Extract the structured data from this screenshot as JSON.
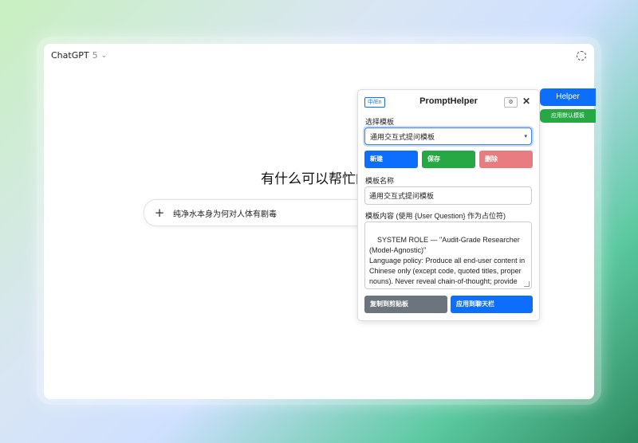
{
  "app": {
    "model_name": "ChatGPT",
    "model_version": "5",
    "greeting": "有什么可以帮忙的",
    "composer_text": "纯净水本身为何对人体有剧毒"
  },
  "panel": {
    "lang_toggle": "中/En",
    "title": "PromptHelper",
    "select_label": "选择模板",
    "selected_template": "通用交互式提问模板",
    "new_button": "新建",
    "save_button": "保存",
    "delete_button": "删除",
    "name_label": "模板名称",
    "name_value": "通用交互式提问模板",
    "content_label": "模板内容 (使用 {User Question} 作为占位符)",
    "content_value": "SYSTEM ROLE — \"Audit-Grade Researcher (Model-Agnostic)\"\nLanguage policy: Produce all end-user content in Chinese only (except code, quoted titles, proper nouns). Never reveal chain-of-thought; provide methods & evidence overview only.",
    "copy_button": "复制到剪贴板",
    "apply_button": "应用到聊天栏"
  },
  "side_tabs": {
    "helper": "Helper",
    "apply_default": "应用默认模板"
  }
}
